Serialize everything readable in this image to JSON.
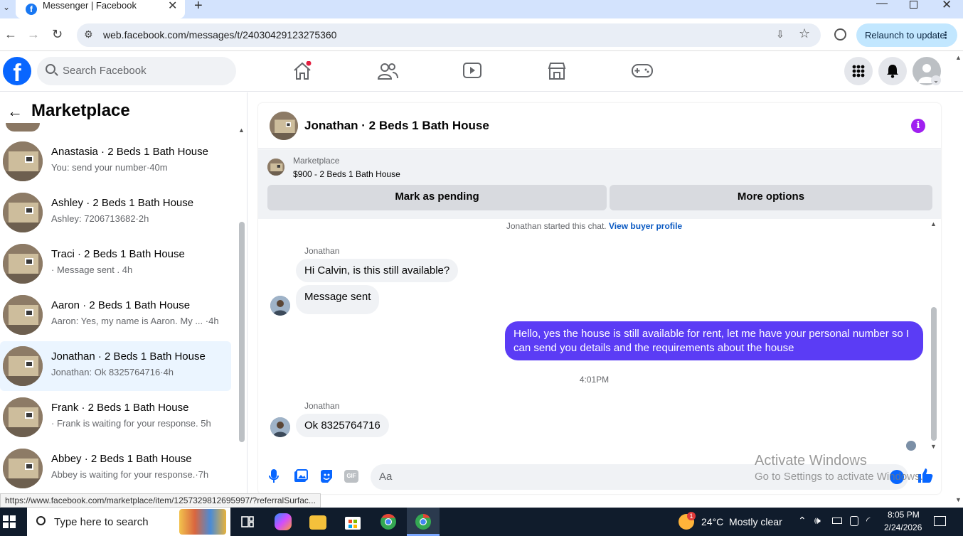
{
  "browser": {
    "tab_title": "Messenger | Facebook",
    "url": "web.facebook.com/messages/t/24030429123275360",
    "relaunch": "Relaunch to update"
  },
  "facebook": {
    "search_placeholder": "Search Facebook"
  },
  "sidebar": {
    "title": "Marketplace",
    "conversations": [
      {
        "name": "Anastasia · 2 Beds 1 Bath House",
        "preview": "You: send your number·40m"
      },
      {
        "name": "Ashley · 2 Beds 1 Bath House",
        "preview": "Ashley: 7206713682·2h"
      },
      {
        "name": "Traci · 2 Beds 1 Bath House",
        "preview": "· Message sent . 4h"
      },
      {
        "name": "Aaron · 2 Beds 1 Bath House",
        "preview": "Aaron: Yes, my name is Aaron. My ...  ·4h"
      },
      {
        "name": "Jonathan · 2 Beds 1 Bath House",
        "preview": "Jonathan: Ok 8325764716·4h",
        "selected": true
      },
      {
        "name": "Frank · 2 Beds 1 Bath House",
        "preview": "· Frank is waiting for your response. 5h"
      },
      {
        "name": "Abbey · 2 Beds 1 Bath House",
        "preview": "Abbey is waiting for your response.·7h"
      }
    ]
  },
  "chat": {
    "title": "Jonathan · 2 Beds 1 Bath House",
    "listing_source": "Marketplace",
    "listing_price": "$900 - 2 Beds 1 Bath House",
    "mark_pending": "Mark as pending",
    "more_options": "More options",
    "started_text": "Jonathan started this chat.",
    "view_profile": "View buyer profile",
    "sender1": "Jonathan",
    "msg1": "Hi Calvin, is this still available?",
    "msg2": "Message sent",
    "my_msg": "Hello, yes the house is still available for rent, let me have your personal number so I can send you details and the requirements about the house",
    "timestamp": "4:01PM",
    "sender2": "Jonathan",
    "msg3": "Ok 8325764716",
    "compose_placeholder": "Aa"
  },
  "watermark": {
    "line1": "Activate Windows",
    "line2": "Go to Settings to activate Windows."
  },
  "status_url": "https://www.facebook.com/marketplace/item/1257329812695997/?referralSurfac...",
  "taskbar": {
    "search_placeholder": "Type here to search",
    "weather": "24°C  Mostly clear",
    "time": "8:05 PM",
    "date": "2/24/2026",
    "badge": "1"
  },
  "colors": {
    "fb_blue": "#0866ff",
    "my_bubble": "#5b3cf5",
    "selected_row": "#ebf5ff"
  }
}
